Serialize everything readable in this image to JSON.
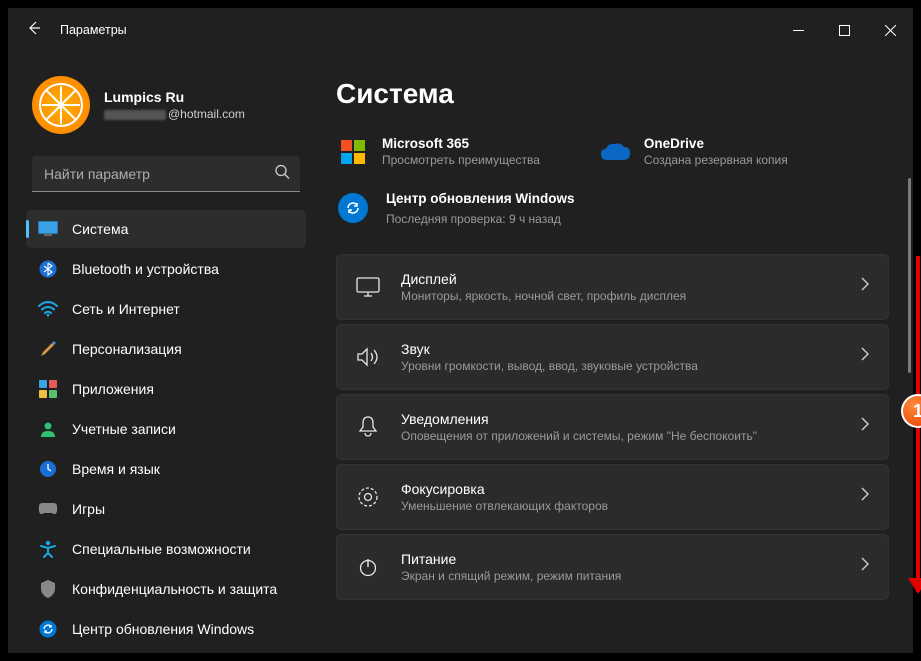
{
  "titlebar": {
    "title": "Параметры"
  },
  "profile": {
    "name": "Lumpics Ru",
    "email_suffix": "@hotmail.com"
  },
  "search": {
    "placeholder": "Найти параметр"
  },
  "nav": {
    "items": [
      {
        "label": "Система"
      },
      {
        "label": "Bluetooth и устройства"
      },
      {
        "label": "Сеть и Интернет"
      },
      {
        "label": "Персонализация"
      },
      {
        "label": "Приложения"
      },
      {
        "label": "Учетные записи"
      },
      {
        "label": "Время и язык"
      },
      {
        "label": "Игры"
      },
      {
        "label": "Специальные возможности"
      },
      {
        "label": "Конфиденциальность и защита"
      },
      {
        "label": "Центр обновления Windows"
      }
    ]
  },
  "main": {
    "heading": "Система",
    "tiles": {
      "ms365": {
        "title": "Microsoft 365",
        "sub": "Просмотреть преимущества"
      },
      "onedrive": {
        "title": "OneDrive",
        "sub": "Создана резервная копия"
      }
    },
    "wu": {
      "title": "Центр обновления Windows",
      "sub": "Последняя проверка: 9 ч назад"
    },
    "rows": [
      {
        "title": "Дисплей",
        "sub": "Мониторы, яркость, ночной свет, профиль дисплея"
      },
      {
        "title": "Звук",
        "sub": "Уровни громкости, вывод, ввод, звуковые устройства"
      },
      {
        "title": "Уведомления",
        "sub": "Оповещения от приложений и системы, режим \"Не беспокоить\""
      },
      {
        "title": "Фокусировка",
        "sub": "Уменьшение отвлекающих факторов"
      },
      {
        "title": "Питание",
        "sub": "Экран и спящий режим, режим питания"
      }
    ]
  },
  "annotation": {
    "badge": "1"
  }
}
